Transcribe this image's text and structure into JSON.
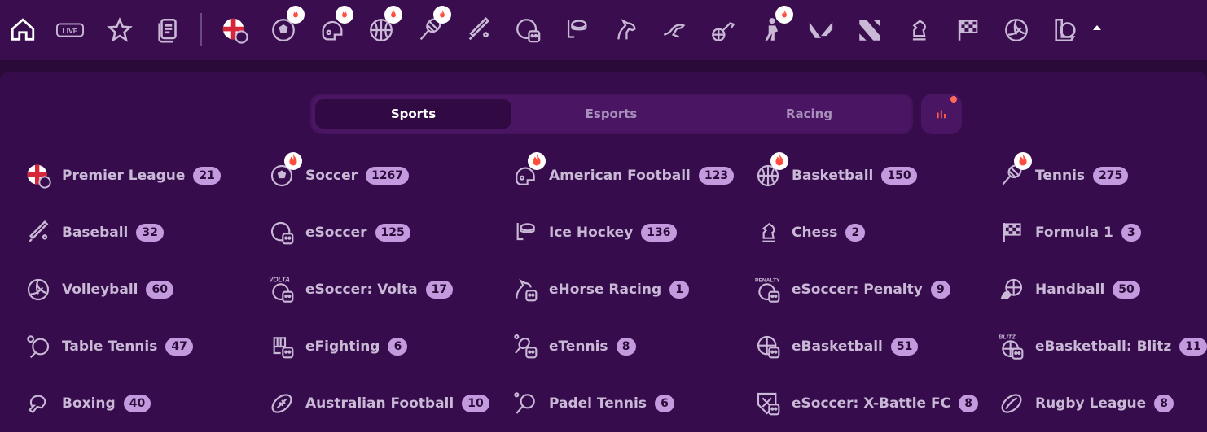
{
  "top_nav": {
    "badge_live": "LIVE",
    "icons": [
      {
        "name": "home-icon",
        "hot": false
      },
      {
        "name": "live-icon",
        "hot": false
      },
      {
        "name": "favorites-star-icon",
        "hot": false
      },
      {
        "name": "betslip-icon",
        "hot": false
      },
      {
        "name": "premier-league-flag-icon",
        "hot": false
      },
      {
        "name": "soccer-ball-icon",
        "hot": true
      },
      {
        "name": "american-football-helmet-icon",
        "hot": true
      },
      {
        "name": "basketball-icon",
        "hot": true
      },
      {
        "name": "tennis-racket-icon",
        "hot": true
      },
      {
        "name": "baseball-bat-icon",
        "hot": false
      },
      {
        "name": "esoccer-icon",
        "hot": false
      },
      {
        "name": "ice-hockey-icon",
        "hot": false
      },
      {
        "name": "horse-racing-icon",
        "hot": false
      },
      {
        "name": "greyhound-racing-icon",
        "hot": false
      },
      {
        "name": "trotting-icon",
        "hot": false
      },
      {
        "name": "counter-strike-icon",
        "hot": true
      },
      {
        "name": "valorant-icon",
        "hot": false
      },
      {
        "name": "dota-icon",
        "hot": false
      },
      {
        "name": "chess-knight-icon",
        "hot": false
      },
      {
        "name": "checkered-flag-icon",
        "hot": false
      },
      {
        "name": "volleyball-icon",
        "hot": false
      },
      {
        "name": "league-of-legends-icon",
        "hot": false
      },
      {
        "name": "collapse-caret-icon",
        "hot": false
      }
    ]
  },
  "tabs": [
    {
      "label": "Sports",
      "active": true
    },
    {
      "label": "Esports",
      "active": false
    },
    {
      "label": "Racing",
      "active": false
    }
  ],
  "stats_button": {
    "icon": "bar-chart-icon",
    "notification": true
  },
  "sports": [
    {
      "label": "Premier League",
      "count": "21",
      "icon": "england-flag-icon",
      "hot": false
    },
    {
      "label": "Soccer",
      "count": "1267",
      "icon": "soccer-ball-icon",
      "hot": true
    },
    {
      "label": "American Football",
      "count": "123",
      "icon": "american-football-helmet-icon",
      "hot": true
    },
    {
      "label": "Basketball",
      "count": "150",
      "icon": "basketball-icon",
      "hot": true
    },
    {
      "label": "Tennis",
      "count": "275",
      "icon": "tennis-racket-icon",
      "hot": true
    },
    {
      "label": "Baseball",
      "count": "32",
      "icon": "baseball-bat-icon",
      "hot": false
    },
    {
      "label": "eSoccer",
      "count": "125",
      "icon": "esoccer-icon",
      "hot": false
    },
    {
      "label": "Ice Hockey",
      "count": "136",
      "icon": "ice-hockey-icon",
      "hot": false
    },
    {
      "label": "Chess",
      "count": "2",
      "icon": "chess-knight-icon",
      "hot": false
    },
    {
      "label": "Formula 1",
      "count": "3",
      "icon": "checkered-flag-icon",
      "hot": false
    },
    {
      "label": "Volleyball",
      "count": "60",
      "icon": "volleyball-icon",
      "hot": false
    },
    {
      "label": "eSoccer: Volta",
      "count": "17",
      "icon": "esoccer-volta-icon",
      "hot": false,
      "tag": "VOLTA"
    },
    {
      "label": "eHorse Racing",
      "count": "1",
      "icon": "ehorse-racing-icon",
      "hot": false
    },
    {
      "label": "eSoccer: Penalty",
      "count": "9",
      "icon": "esoccer-penalty-icon",
      "hot": false,
      "tag": "PENALTY"
    },
    {
      "label": "Handball",
      "count": "50",
      "icon": "handball-icon",
      "hot": false
    },
    {
      "label": "Table Tennis",
      "count": "47",
      "icon": "table-tennis-icon",
      "hot": false
    },
    {
      "label": "eFighting",
      "count": "6",
      "icon": "efighting-icon",
      "hot": false
    },
    {
      "label": "eTennis",
      "count": "8",
      "icon": "etennis-icon",
      "hot": false
    },
    {
      "label": "eBasketball",
      "count": "51",
      "icon": "ebasketball-icon",
      "hot": false
    },
    {
      "label": "eBasketball: Blitz",
      "count": "11",
      "icon": "ebasketball-blitz-icon",
      "hot": false,
      "tag": "BLITZ"
    },
    {
      "label": "Boxing",
      "count": "40",
      "icon": "boxing-glove-icon",
      "hot": false
    },
    {
      "label": "Australian Football",
      "count": "10",
      "icon": "australian-football-icon",
      "hot": false
    },
    {
      "label": "Padel Tennis",
      "count": "6",
      "icon": "padel-racket-icon",
      "hot": false
    },
    {
      "label": "eSoccer: X-Battle FC",
      "count": "8",
      "icon": "esoccer-xbattle-icon",
      "hot": false
    },
    {
      "label": "Rugby League",
      "count": "8",
      "icon": "rugby-ball-icon",
      "hot": false
    }
  ],
  "colors": {
    "background": "#2b0b3a",
    "panel": "#360c4c",
    "count_badge": "#c39ade",
    "accent_red": "#ff4d3d",
    "icon_stroke": "#c9b9d6"
  }
}
